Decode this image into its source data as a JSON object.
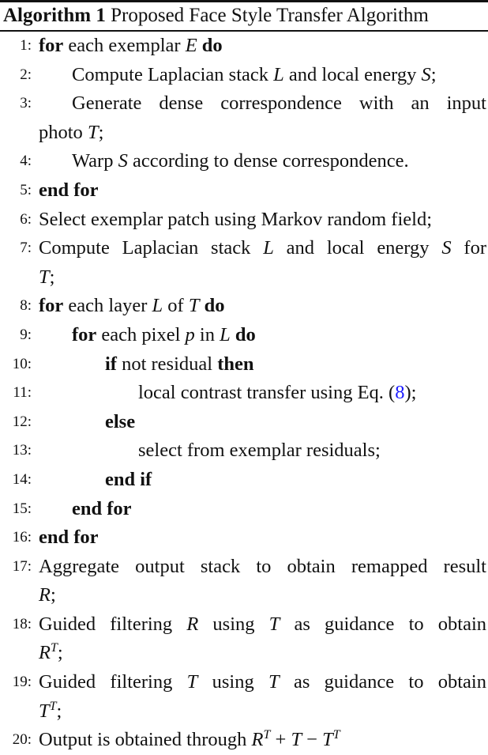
{
  "caption": {
    "label": "Algorithm 1",
    "title": "Proposed Face Style Transfer Algorithm"
  },
  "colors": {
    "reference_link": "#1a1aff"
  },
  "lines": [
    {
      "num": "1:",
      "indent": 0,
      "parts": [
        {
          "t": "for",
          "s": "kw"
        },
        {
          "t": " each exemplar "
        },
        {
          "t": "E",
          "s": "m"
        },
        {
          "t": " "
        },
        {
          "t": "do",
          "s": "kw"
        }
      ]
    },
    {
      "num": "2:",
      "indent": 1,
      "parts": [
        {
          "t": "Compute Laplacian stack "
        },
        {
          "t": "L",
          "s": "m"
        },
        {
          "t": " and local energy "
        },
        {
          "t": "S",
          "s": "m"
        },
        {
          "t": ";"
        }
      ]
    },
    {
      "num": "3:",
      "indent": 1,
      "justify": true,
      "parts": [
        {
          "t": "Generate dense correspondence with an input"
        }
      ]
    },
    {
      "num": "",
      "indent": 0,
      "cont": true,
      "parts": [
        {
          "t": "photo "
        },
        {
          "t": "T",
          "s": "m"
        },
        {
          "t": ";"
        }
      ]
    },
    {
      "num": "4:",
      "indent": 1,
      "parts": [
        {
          "t": "Warp "
        },
        {
          "t": "S",
          "s": "m"
        },
        {
          "t": " according to dense correspondence."
        }
      ]
    },
    {
      "num": "5:",
      "indent": 0,
      "parts": [
        {
          "t": "end for",
          "s": "kw"
        }
      ]
    },
    {
      "num": "6:",
      "indent": 0,
      "parts": [
        {
          "t": "Select exemplar patch using Markov random field;"
        }
      ]
    },
    {
      "num": "7:",
      "indent": 0,
      "justify": true,
      "parts": [
        {
          "t": "Compute Laplacian stack "
        },
        {
          "t": "L",
          "s": "m"
        },
        {
          "t": " and local energy "
        },
        {
          "t": "S",
          "s": "m"
        },
        {
          "t": " for"
        }
      ]
    },
    {
      "num": "",
      "indent": 0,
      "cont": true,
      "parts": [
        {
          "t": "T",
          "s": "m"
        },
        {
          "t": ";"
        }
      ]
    },
    {
      "num": "8:",
      "indent": 0,
      "parts": [
        {
          "t": "for",
          "s": "kw"
        },
        {
          "t": " each layer "
        },
        {
          "t": "L",
          "s": "m"
        },
        {
          "t": " of "
        },
        {
          "t": "T",
          "s": "m"
        },
        {
          "t": " "
        },
        {
          "t": "do",
          "s": "kw"
        }
      ]
    },
    {
      "num": "9:",
      "indent": 1,
      "parts": [
        {
          "t": "for",
          "s": "kw"
        },
        {
          "t": " each pixel "
        },
        {
          "t": "p",
          "s": "m"
        },
        {
          "t": " in "
        },
        {
          "t": "L",
          "s": "m"
        },
        {
          "t": " "
        },
        {
          "t": "do",
          "s": "kw"
        }
      ]
    },
    {
      "num": "10:",
      "indent": 2,
      "parts": [
        {
          "t": "if",
          "s": "kw"
        },
        {
          "t": " not residual "
        },
        {
          "t": "then",
          "s": "kw"
        }
      ]
    },
    {
      "num": "11:",
      "indent": 3,
      "parts": [
        {
          "t": "local contrast transfer using Eq. ("
        },
        {
          "t": "8",
          "s": "ref"
        },
        {
          "t": ");"
        }
      ]
    },
    {
      "num": "12:",
      "indent": 2,
      "parts": [
        {
          "t": "else",
          "s": "kw"
        }
      ]
    },
    {
      "num": "13:",
      "indent": 3,
      "parts": [
        {
          "t": "select from exemplar residuals;"
        }
      ]
    },
    {
      "num": "14:",
      "indent": 2,
      "parts": [
        {
          "t": "end if",
          "s": "kw"
        }
      ]
    },
    {
      "num": "15:",
      "indent": 1,
      "parts": [
        {
          "t": "end for",
          "s": "kw"
        }
      ]
    },
    {
      "num": "16:",
      "indent": 0,
      "parts": [
        {
          "t": "end for",
          "s": "kw"
        }
      ]
    },
    {
      "num": "17:",
      "indent": 0,
      "justify": true,
      "parts": [
        {
          "t": "Aggregate output stack to obtain remapped result"
        }
      ]
    },
    {
      "num": "",
      "indent": 0,
      "cont": true,
      "parts": [
        {
          "t": "R",
          "s": "m"
        },
        {
          "t": ";"
        }
      ]
    },
    {
      "num": "18:",
      "indent": 0,
      "justify": true,
      "parts": [
        {
          "t": "Guided filtering "
        },
        {
          "t": "R",
          "s": "m"
        },
        {
          "t": " using "
        },
        {
          "t": "T",
          "s": "m"
        },
        {
          "t": " as guidance to obtain"
        }
      ]
    },
    {
      "num": "",
      "indent": 0,
      "cont": true,
      "parts": [
        {
          "t": "R",
          "s": "m",
          "sup": "T"
        },
        {
          "t": ";"
        }
      ]
    },
    {
      "num": "19:",
      "indent": 0,
      "justify": true,
      "parts": [
        {
          "t": "Guided filtering "
        },
        {
          "t": "T",
          "s": "m"
        },
        {
          "t": " using "
        },
        {
          "t": "T",
          "s": "m"
        },
        {
          "t": " as guidance to obtain"
        }
      ]
    },
    {
      "num": "",
      "indent": 0,
      "cont": true,
      "parts": [
        {
          "t": "T",
          "s": "m",
          "sup": "T"
        },
        {
          "t": ";"
        }
      ]
    },
    {
      "num": "20:",
      "indent": 0,
      "parts": [
        {
          "t": "Output is obtained through "
        },
        {
          "t": "R",
          "s": "m",
          "sup": "T"
        },
        {
          "t": " + "
        },
        {
          "t": "T",
          "s": "m"
        },
        {
          "t": " − "
        },
        {
          "t": "T",
          "s": "m",
          "sup": "T"
        }
      ]
    }
  ]
}
